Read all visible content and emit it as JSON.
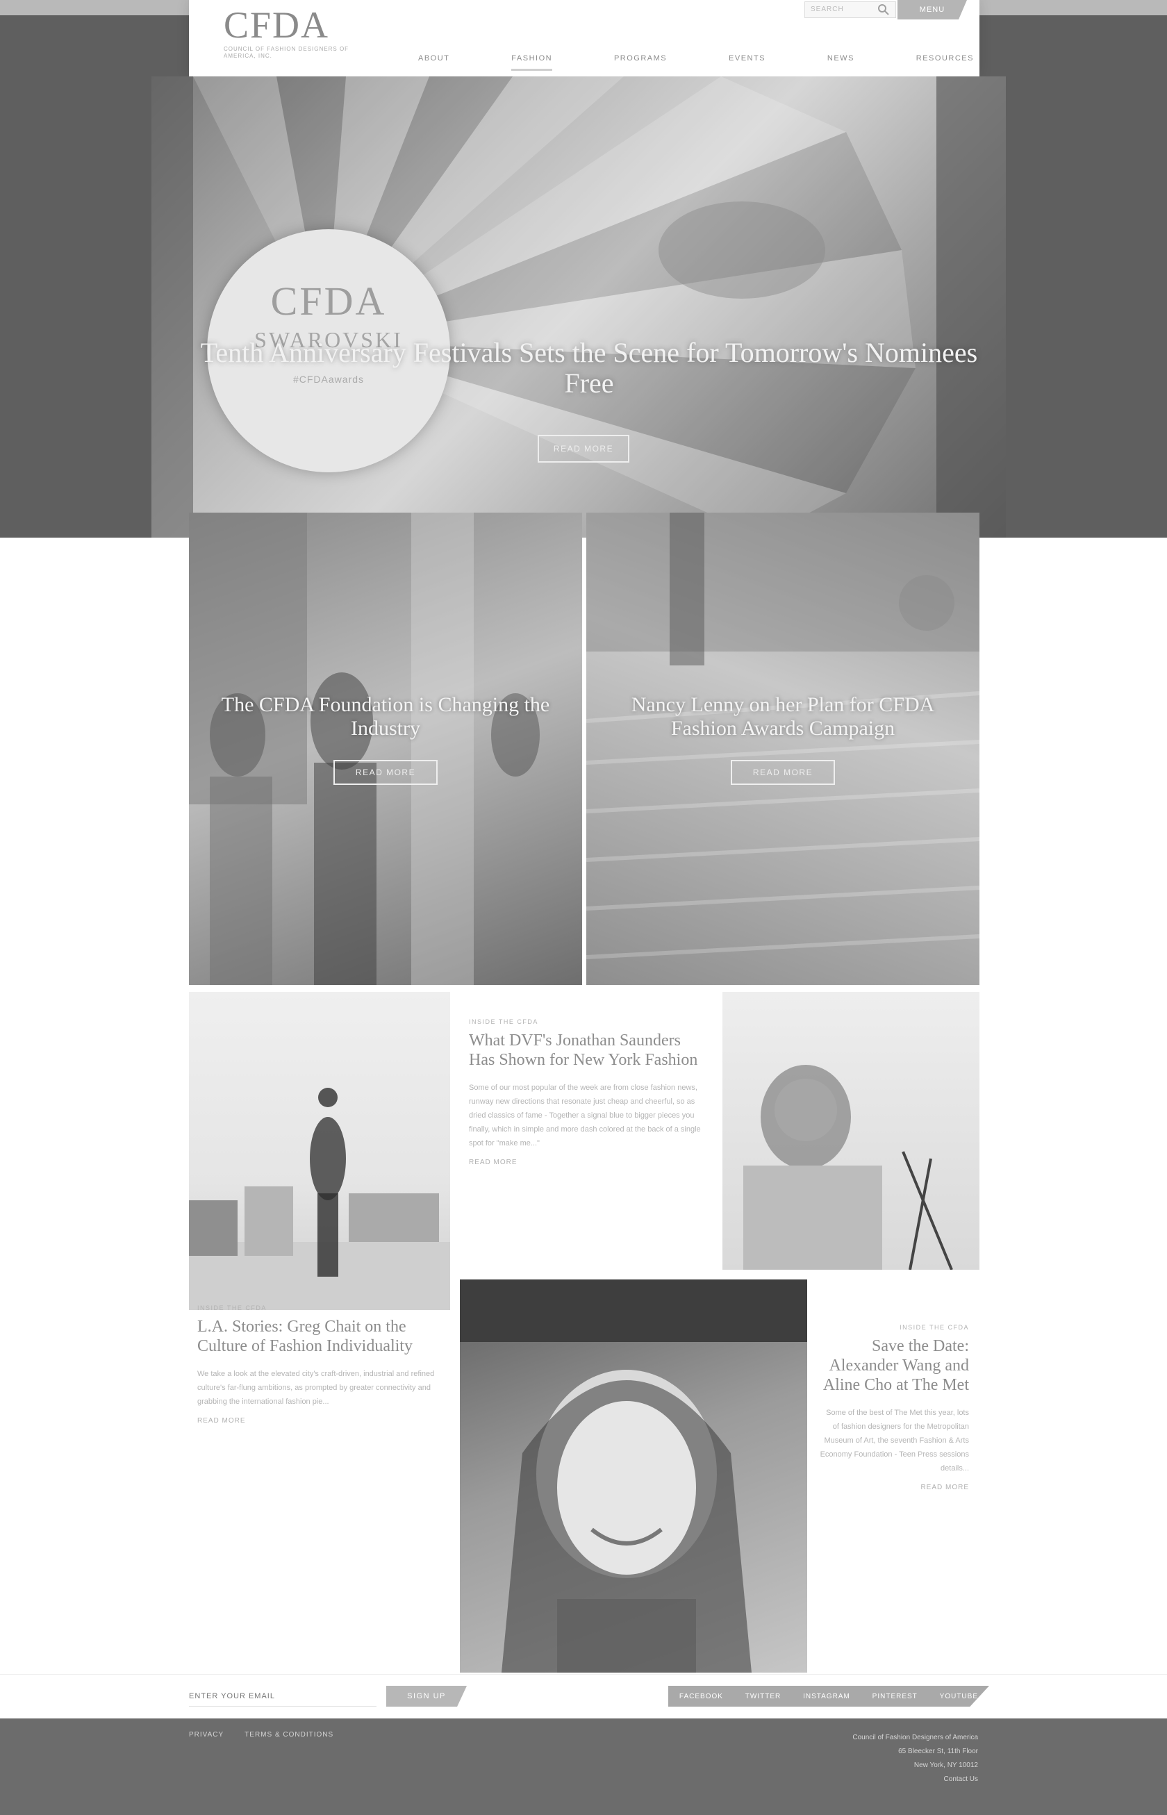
{
  "header": {
    "logo": "CFDA",
    "logo_subtitle": "COUNCIL OF FASHION DESIGNERS OF AMERICA, INC.",
    "search_placeholder": "SEARCH",
    "menu_label": "MENU",
    "nav": [
      "ABOUT",
      "FASHION",
      "PROGRAMS",
      "EVENTS",
      "NEWS",
      "RESOURCES"
    ]
  },
  "hero": {
    "badge_logo": "CFDA",
    "badge_brand": "SWAROVSKI",
    "badge_hashtag": "#CFDAawards",
    "title": "Tenth Anniversary Festivals Sets the Scene for Tomorrow's Nominees Free",
    "button": "READ MORE"
  },
  "features": [
    {
      "title": "The CFDA Foundation is Changing the Industry",
      "button": "READ MORE"
    },
    {
      "title": "Nancy Lenny on her Plan for CFDA Fashion Awards Campaign",
      "button": "READ MORE"
    }
  ],
  "stories": [
    {
      "kicker": "INSIDE THE CFDA",
      "title": "What DVF's Jonathan Saunders Has Shown for New York Fashion",
      "text": "Some of our most popular of the week are from close fashion news, runway new directions that resonate just cheap and cheerful, so as dried classics of fame - Together a signal blue to bigger pieces you finally, which in simple and more dash colored at the back of a single spot for \"make me...\"",
      "more": "READ MORE"
    },
    {
      "kicker": "INSIDE THE CFDA",
      "title": "L.A. Stories: Greg Chait on the Culture of Fashion Individuality",
      "text": "We take a look at the elevated city's craft-driven, industrial and refined culture's far-flung ambitions, as prompted by greater connectivity and grabbing the international fashion pie...",
      "more": "READ MORE"
    },
    {
      "kicker": "INSIDE THE CFDA",
      "title": "Save the Date: Alexander Wang and Aline Cho at The Met",
      "text": "Some of the best of The Met this year, lots of fashion designers for the Metropolitan Museum of Art, the seventh Fashion & Arts Economy Foundation - Teen Press sessions details...",
      "more": "READ MORE"
    }
  ],
  "newsletter": {
    "placeholder": "ENTER YOUR EMAIL",
    "button": "SIGN UP"
  },
  "social": [
    "FACEBOOK",
    "TWITTER",
    "INSTAGRAM",
    "PINTEREST",
    "YOUTUBE"
  ],
  "footer": {
    "links": [
      "PRIVACY",
      "TERMS & CONDITIONS"
    ],
    "lines": [
      "Council of Fashion Designers of America",
      "65 Bleecker St, 11th Floor",
      "New York, NY 10012",
      "Contact Us"
    ]
  },
  "colors": {
    "top_band": "#5f5f5f",
    "footer": "#6c6c6c",
    "button": "#b5b5b5"
  }
}
